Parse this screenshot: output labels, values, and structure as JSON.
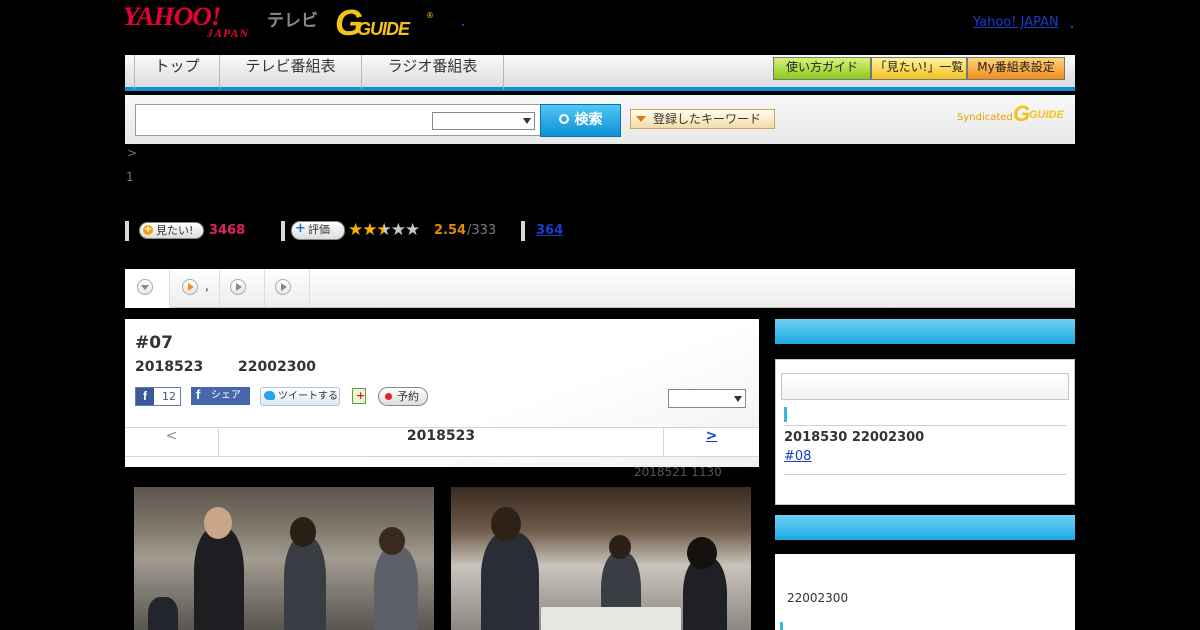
{
  "header": {
    "yahoo_logo": "YAHOO!",
    "yahoo_logo_sub": "JAPAN",
    "tv_label": "テレビ",
    "gguide_logo": "GUIDE",
    "yahoo_japan_link": "Yahoo! JAPAN"
  },
  "nav": {
    "tabs": [
      "トップ",
      "テレビ番組表",
      "ラジオ番組表"
    ],
    "buttons": {
      "guide": "使い方ガイド",
      "wishlist": "「見たい!」一覧",
      "my_schedule": "My番組表設定"
    }
  },
  "search": {
    "button_label": "検索",
    "keyword_button": "登録したキーワード",
    "syndicated_label": "Syndicated",
    "syndicated_logo": "GUIDE"
  },
  "breadcrumb": {
    "separator": ">",
    "page_number": "1"
  },
  "stats": {
    "want_label": "見たい!",
    "want_count": "3468",
    "rate_label": "評価",
    "rating": 2.54,
    "rating_text": "2.54",
    "rating_count": "/333",
    "link_count": "364"
  },
  "program": {
    "episode": "#07",
    "date": "2018523",
    "time": "22002300",
    "fb_like_count": "12",
    "fb_share_label": "シェア",
    "tweet_label": "ツイートする",
    "reserve_label": "予約",
    "pager": {
      "prev": "<",
      "current": "2018523",
      "next": ">"
    },
    "updated": "2018521  1130"
  },
  "tabs_bar": {
    "second_label": ","
  },
  "sidebar": {
    "next_datetime": "2018530  22002300",
    "next_episode": "#08",
    "time2": "22002300"
  },
  "colors": {
    "accent_blue": "#0b92d8",
    "want_pink": "#e0245e",
    "rating_orange": "#e38a00",
    "link_blue": "#1a3ccc"
  }
}
